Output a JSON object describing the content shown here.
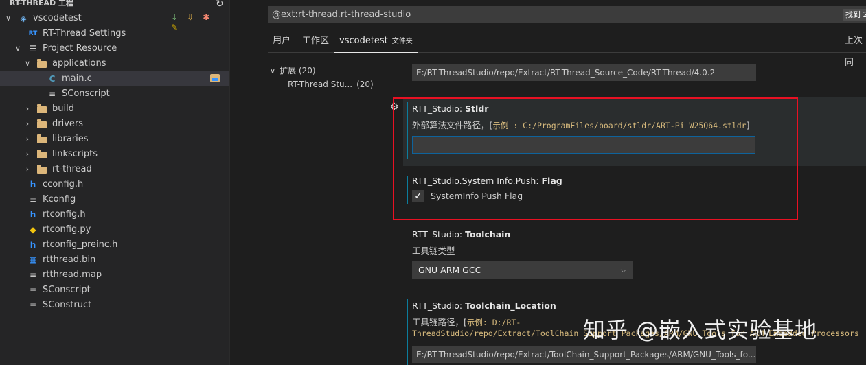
{
  "explorer": {
    "title": "RT-THREAD 工程",
    "refresh_icon": "refresh-icon",
    "tree": [
      {
        "label": "vscodetest",
        "type": "project",
        "icon": "stack-icon",
        "chevron": "expanded"
      },
      {
        "label": "RT-Thread Settings",
        "type": "settings",
        "icon": "rt-logo-icon"
      },
      {
        "label": "Project Resource",
        "type": "group",
        "icon": "list-icon",
        "chevron": "expanded"
      },
      {
        "label": "applications",
        "type": "folder",
        "chevron": "expanded"
      },
      {
        "label": "main.c",
        "type": "c-file",
        "icon": "c-icon",
        "selected": true
      },
      {
        "label": "SConscript",
        "type": "file"
      },
      {
        "label": "build",
        "type": "folder",
        "chevron": "collapsed"
      },
      {
        "label": "drivers",
        "type": "folder",
        "chevron": "collapsed"
      },
      {
        "label": "libraries",
        "type": "folder",
        "chevron": "collapsed"
      },
      {
        "label": "linkscripts",
        "type": "folder",
        "chevron": "collapsed"
      },
      {
        "label": "rt-thread",
        "type": "folder",
        "chevron": "collapsed"
      },
      {
        "label": "cconfig.h",
        "type": "h-file"
      },
      {
        "label": "Kconfig",
        "type": "file"
      },
      {
        "label": "rtconfig.h",
        "type": "h-file"
      },
      {
        "label": "rtconfig.py",
        "type": "py-file"
      },
      {
        "label": "rtconfig_preinc.h",
        "type": "h-file"
      },
      {
        "label": "rtthread.bin",
        "type": "bin-file"
      },
      {
        "label": "rtthread.map",
        "type": "file"
      },
      {
        "label": "SConscript",
        "type": "file"
      },
      {
        "label": "SConstruct",
        "type": "file"
      }
    ],
    "toolbar_icons": [
      "sort-icon",
      "download-icon",
      "debug-icon",
      "clean-icon"
    ]
  },
  "settings": {
    "search_value": "@ext:rt-thread.rt-thread-studio",
    "search_count": "找到 2",
    "tabs": [
      {
        "label": "用户"
      },
      {
        "label": "工作区"
      },
      {
        "label": "vscodetest",
        "sub": "文件夹",
        "active": true
      }
    ],
    "last_sync": "上次同",
    "toc": {
      "header": "扩展",
      "header_count": "(20)",
      "item": "RT-Thread Stu...",
      "item_count": "(20)"
    },
    "rtthread_path_value": "E:/RT-ThreadStudio/repo/Extract/RT-Thread_Source_Code/RT-Thread/4.0.2",
    "stldr": {
      "title_prefix": "RTT_Studio: ",
      "title_key": "Stldr",
      "desc": "外部算法文件路径，[",
      "example_label": "示例 :",
      "example_path": " C:/ProgramFiles/board/stldr/ART-Pi_W25Q64.stldr",
      "desc_end": "]",
      "value": ""
    },
    "sysinfo": {
      "title_prefix": "RTT_Studio.System Info.Push: ",
      "title_key": "Flag",
      "checkbox_label": "SystemInfo Push Flag",
      "checked": true
    },
    "toolchain": {
      "title_prefix": "RTT_Studio: ",
      "title_key": "Toolchain",
      "desc": "工具链类型",
      "selected": "GNU ARM GCC"
    },
    "toolchain_location": {
      "title_prefix": "RTT_Studio: ",
      "title_key": "Toolchain_Location",
      "desc_line1_a": "工具链路径，[",
      "desc_line1_b": "示例:",
      "desc_line1_c": " D:/RT-",
      "desc_line2": "ThreadStudio/repo/Extract/ToolChain_Support_Packages/ARM/GNU_Tools_for_ARM_Embedded_Processors",
      "value": "E:/RT-ThreadStudio/repo/Extract/ToolChain_Support_Packages/ARM/GNU_Tools_fo..."
    }
  },
  "watermark": "知乎 @嵌入式实验基地",
  "colors": {
    "highlight_box": "#e81123",
    "modified_bar": "#0c7d9d",
    "folder": "#dcb67a"
  }
}
